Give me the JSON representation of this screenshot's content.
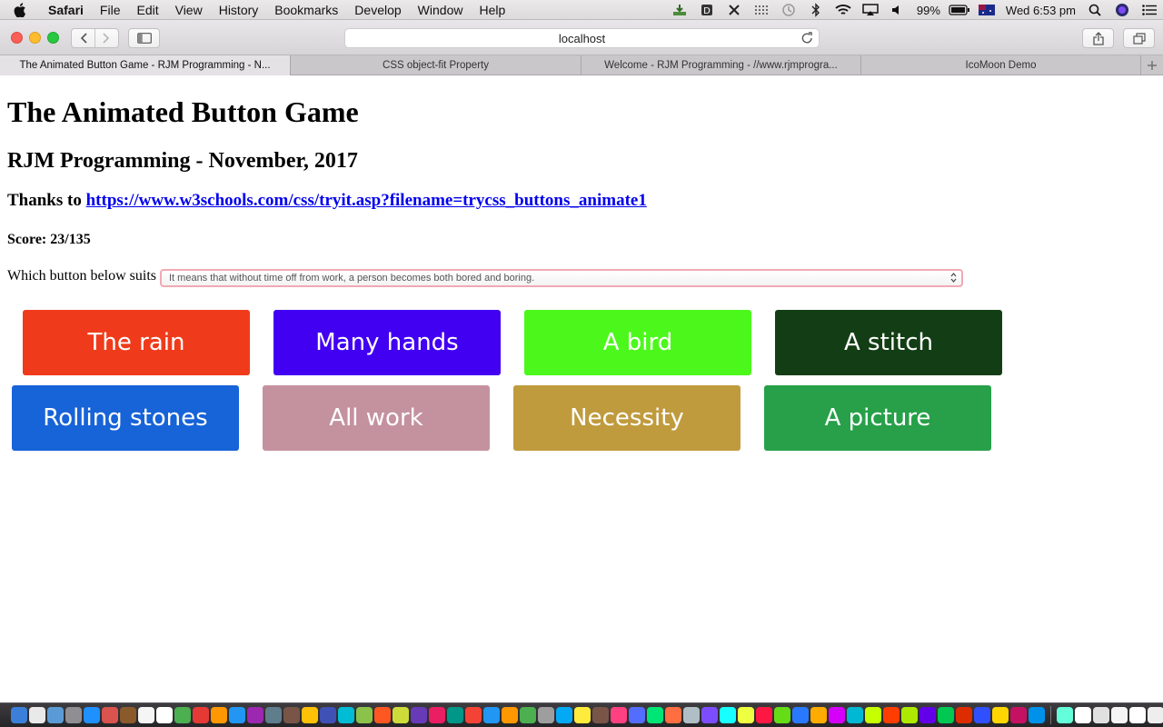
{
  "menubar": {
    "app": "Safari",
    "items": [
      "File",
      "Edit",
      "View",
      "History",
      "Bookmarks",
      "Develop",
      "Window",
      "Help"
    ],
    "battery": "99%",
    "clock": "Wed 6:53 pm"
  },
  "toolbar": {
    "address": "localhost"
  },
  "tabs": [
    {
      "label": "The Animated Button Game - RJM Programming - N..."
    },
    {
      "label": "CSS object-fit Property"
    },
    {
      "label": "Welcome - RJM Programming - //www.rjmprogra..."
    },
    {
      "label": "IcoMoon Demo"
    }
  ],
  "page": {
    "title": "The Animated Button Game",
    "subtitle": "RJM Programming - November, 2017",
    "thanks_prefix": "Thanks to ",
    "thanks_link": "https://www.w3schools.com/css/tryit.asp?filename=trycss_buttons_animate1",
    "score": "Score: 23/135",
    "question": "Which button below suits",
    "select_value": "It means that without time off from work, a person becomes both bored and boring."
  },
  "buttons": [
    {
      "label": "The rain",
      "color": "#ef3b1b"
    },
    {
      "label": "Many hands",
      "color": "#4100f2"
    },
    {
      "label": "A bird",
      "color": "#4cf81b"
    },
    {
      "label": "A stitch",
      "color": "#133e15"
    },
    {
      "label": "Rolling stones",
      "color": "#1763d8"
    },
    {
      "label": "All work",
      "color": "#c4929f"
    },
    {
      "label": "Necessity",
      "color": "#c09b3e"
    },
    {
      "label": "A picture",
      "color": "#27a049"
    }
  ],
  "dock_colors": [
    "#3b7fd9",
    "#e9e9e9",
    "#5b9bd5",
    "#8e8e93",
    "#1e90ff",
    "#d9534f",
    "#8b5a2b",
    "#f5f5f5",
    "#ffffff",
    "#4caf50",
    "#e53935",
    "#ff9800",
    "#2196f3",
    "#9c27b0",
    "#607d8b",
    "#795548",
    "#ffc107",
    "#3f51b5",
    "#00bcd4",
    "#8bc34a",
    "#ff5722",
    "#cddc39",
    "#673ab7",
    "#e91e63",
    "#009688",
    "#f44336",
    "#2196f3",
    "#ff9800",
    "#4caf50",
    "#9e9e9e",
    "#03a9f4",
    "#ffeb3b",
    "#795548",
    "#ff4081",
    "#536dfe",
    "#00e676",
    "#ff6e40",
    "#b0bec5",
    "#7c4dff",
    "#18ffff",
    "#eeff41",
    "#ff1744",
    "#64dd17",
    "#2979ff",
    "#ffab00",
    "#d500f9",
    "#00b8d4",
    "#c6ff00",
    "#ff3d00",
    "#aeea00",
    "#6200ea",
    "#00c853",
    "#dd2c00",
    "#304ffe",
    "#ffd600",
    "#c51162",
    "#0091ea",
    "#64ffda",
    "#ffffff",
    "#e0e0e0",
    "#f5f5f5",
    "#ffffff",
    "#eeeeee",
    "#fafafa",
    "#ffffff",
    "#e0e0e0",
    "#f5f5f5",
    "#ffffff",
    "#eeeeee",
    "#fafafa",
    "#ffffff",
    "#cccccc"
  ]
}
